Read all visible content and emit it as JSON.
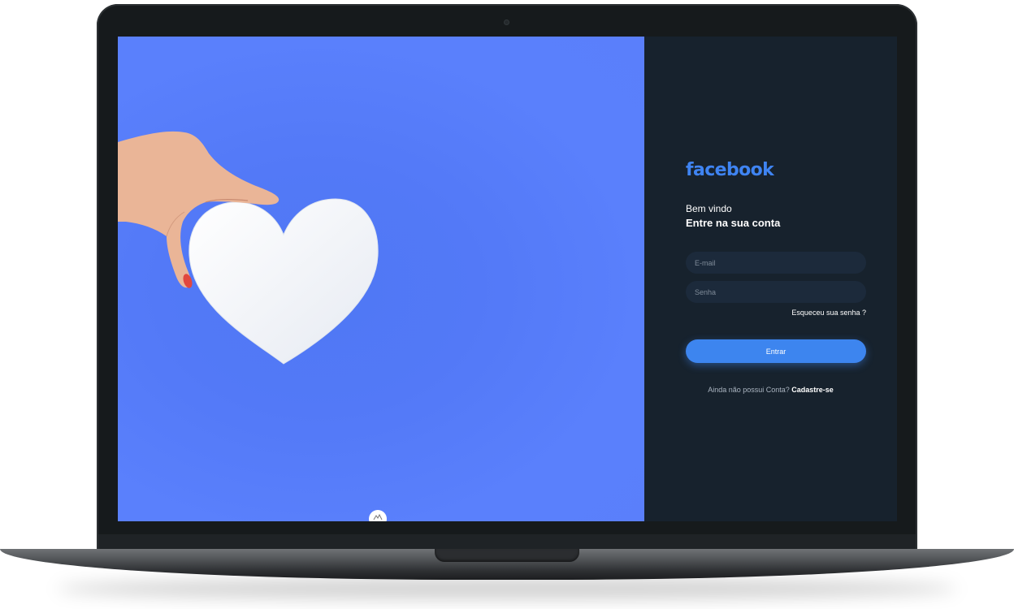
{
  "login": {
    "brand": "facebook",
    "welcome": "Bem vindo",
    "subtitle": "Entre na sua conta",
    "email_placeholder": "E-mail",
    "password_placeholder": "Senha",
    "forgot_label": "Esqueceu sua senha ?",
    "submit_label": "Entrar",
    "signup_prompt": "Ainda não possui Conta?",
    "signup_label": "Cadastre-se"
  },
  "icons": {
    "hero_image": "hand-holding-heart-photo",
    "bottom_badge": "mountain-icon",
    "camera": "camera-icon"
  },
  "colors": {
    "hero_blue": "#5a7ffb",
    "panel_bg": "#17222d",
    "brand_blue": "#3f84f2",
    "button_blue": "#3d85ef",
    "input_bg": "#1c2a3b"
  }
}
